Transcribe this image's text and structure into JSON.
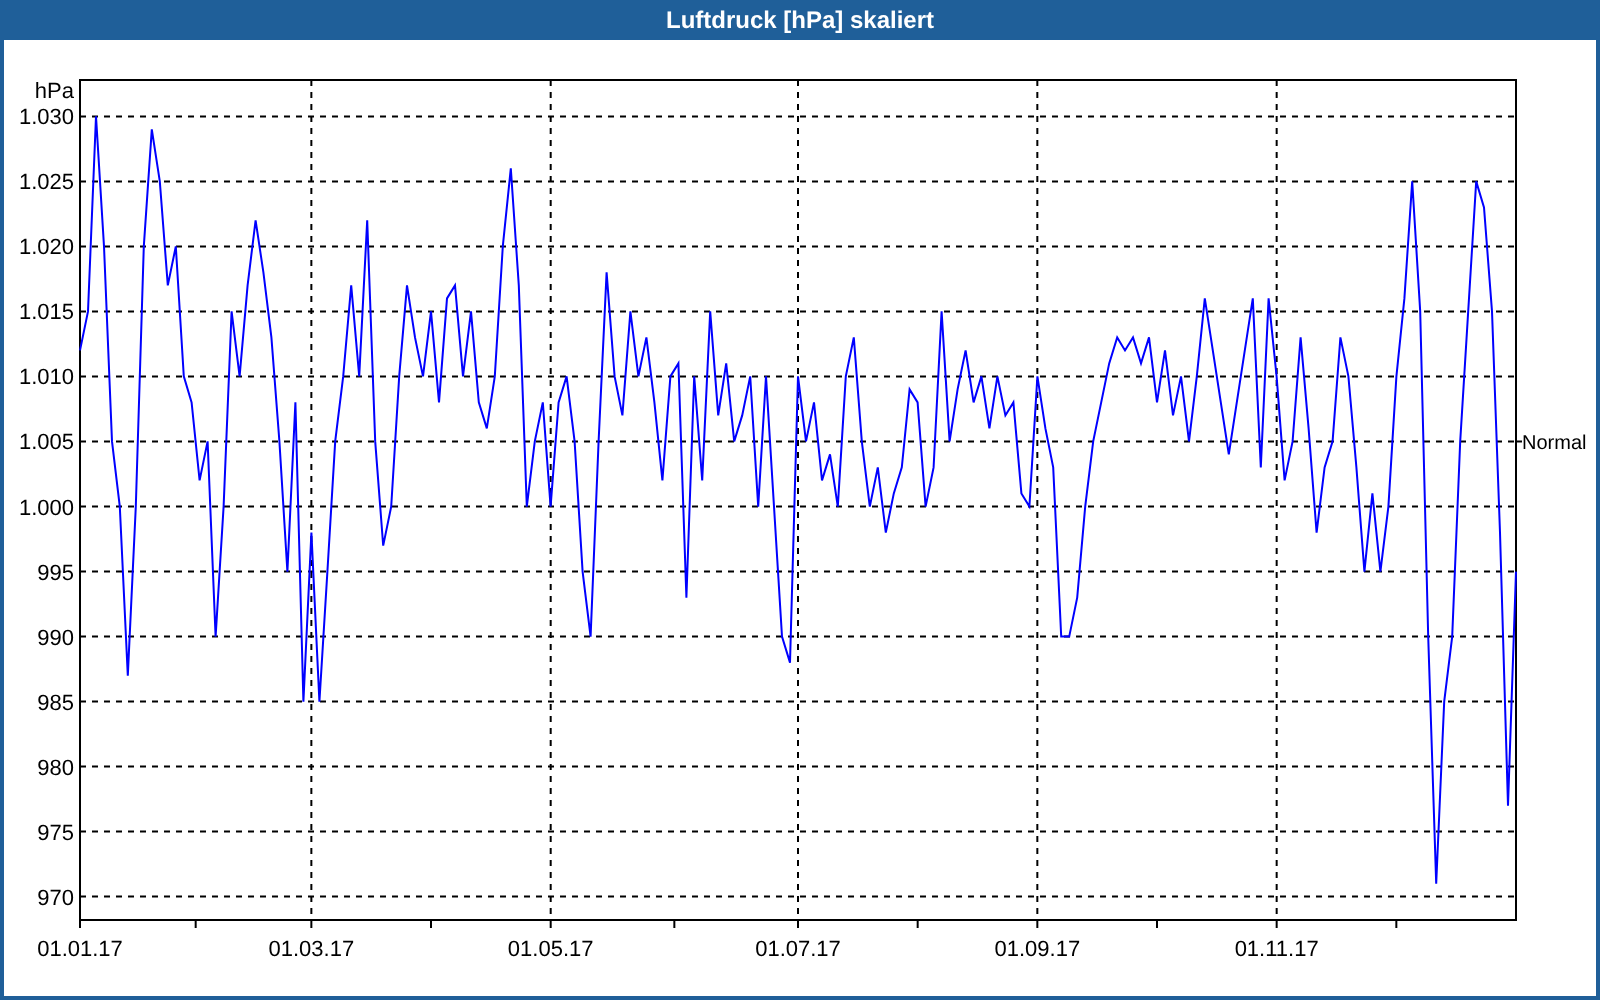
{
  "window": {
    "title": "Luftdruck [hPa] skaliert"
  },
  "chart": {
    "chart_data": {
      "type": "line",
      "ylabel": "hPa",
      "ylim": [
        968.2,
        1032.8
      ],
      "grid": true,
      "yticks": [
        {
          "value": 1030,
          "label": "1.030"
        },
        {
          "value": 1025,
          "label": "1.025"
        },
        {
          "value": 1020,
          "label": "1.020"
        },
        {
          "value": 1015,
          "label": "1.015"
        },
        {
          "value": 1010,
          "label": "1.010"
        },
        {
          "value": 1005,
          "label": "1.005"
        },
        {
          "value": 1000,
          "label": "1.000"
        },
        {
          "value": 995,
          "label": "995"
        },
        {
          "value": 990,
          "label": "990"
        },
        {
          "value": 985,
          "label": "985"
        },
        {
          "value": 980,
          "label": "980"
        },
        {
          "value": 975,
          "label": "975"
        },
        {
          "value": 970,
          "label": "970"
        }
      ],
      "categories": [
        "01.01.17",
        null,
        null,
        null,
        null,
        null,
        null,
        null,
        null,
        null,
        null,
        null,
        null,
        null,
        null,
        null,
        null,
        null,
        null,
        null,
        null,
        null,
        null,
        null,
        null,
        null,
        null,
        null,
        null,
        "01.03.17",
        null,
        null,
        null,
        null,
        null,
        null,
        null,
        null,
        null,
        null,
        null,
        null,
        null,
        null,
        null,
        null,
        null,
        null,
        null,
        null,
        null,
        null,
        null,
        null,
        null,
        null,
        null,
        null,
        null,
        "01.05.17",
        null,
        null,
        null,
        null,
        null,
        null,
        null,
        null,
        null,
        null,
        null,
        null,
        null,
        null,
        null,
        null,
        null,
        null,
        null,
        null,
        null,
        null,
        null,
        null,
        null,
        null,
        null,
        null,
        null,
        null,
        "01.07.17",
        null,
        null,
        null,
        null,
        null,
        null,
        null,
        null,
        null,
        null,
        null,
        null,
        null,
        null,
        null,
        null,
        null,
        null,
        null,
        null,
        null,
        null,
        null,
        null,
        null,
        null,
        null,
        null,
        null,
        "01.09.17",
        null,
        null,
        null,
        null,
        null,
        null,
        null,
        null,
        null,
        null,
        null,
        null,
        null,
        null,
        null,
        null,
        null,
        null,
        null,
        null,
        null,
        null,
        null,
        null,
        null,
        null,
        null,
        null,
        null,
        "01.11.17",
        null,
        null,
        null,
        null,
        null,
        null,
        null,
        null,
        null,
        null,
        null,
        null,
        null,
        null,
        null,
        null,
        null,
        null,
        null,
        null,
        null,
        null,
        null,
        null,
        null,
        null,
        null,
        null,
        null,
        null
      ],
      "annotations": [
        "Normal"
      ],
      "series": [
        {
          "color": "#0000ff",
          "values": [
            1012,
            1015,
            1030,
            1020,
            1005,
            1000,
            987,
            1000,
            1020,
            1029,
            1025,
            1017,
            1020,
            1010,
            1008,
            1002,
            1005,
            990,
            1000,
            1015,
            1010,
            1017,
            1022,
            1018,
            1013,
            1005,
            995,
            1008,
            985,
            998,
            985,
            995,
            1005,
            1010,
            1017,
            1010,
            1022,
            1005,
            997,
            1000,
            1010,
            1017,
            1013,
            1010,
            1015,
            1008,
            1016,
            1017,
            1010,
            1015,
            1008,
            1006,
            1010,
            1020,
            1026,
            1017,
            1000,
            1005,
            1008,
            1000,
            1008,
            1010,
            1005,
            995,
            990,
            1005,
            1018,
            1010,
            1007,
            1015,
            1010,
            1013,
            1008,
            1002,
            1010,
            1011,
            993,
            1010,
            1002,
            1015,
            1007,
            1011,
            1005,
            1007,
            1010,
            1000,
            1010,
            1000,
            990,
            988,
            1010,
            1005,
            1008,
            1002,
            1004,
            1000,
            1010,
            1013,
            1005,
            1000,
            1003,
            998,
            1001,
            1003,
            1009,
            1008,
            1000,
            1003,
            1015,
            1005,
            1009,
            1012,
            1008,
            1010,
            1006,
            1010,
            1007,
            1008,
            1001,
            1000,
            1010,
            1006,
            1003,
            990,
            990,
            993,
            1000,
            1005,
            1008,
            1011,
            1013,
            1012,
            1013,
            1011,
            1013,
            1008,
            1012,
            1007,
            1010,
            1005,
            1010,
            1016,
            1012,
            1008,
            1004,
            1008,
            1012,
            1016,
            1003,
            1016,
            1010,
            1002,
            1005,
            1013,
            1006,
            998,
            1003,
            1005,
            1013,
            1010,
            1003,
            995,
            1001,
            995,
            1000,
            1010,
            1016,
            1025,
            1015,
            990,
            971,
            985,
            990,
            1005,
            1015,
            1025,
            1023,
            1015,
            998,
            977,
            995
          ]
        }
      ]
    }
  }
}
